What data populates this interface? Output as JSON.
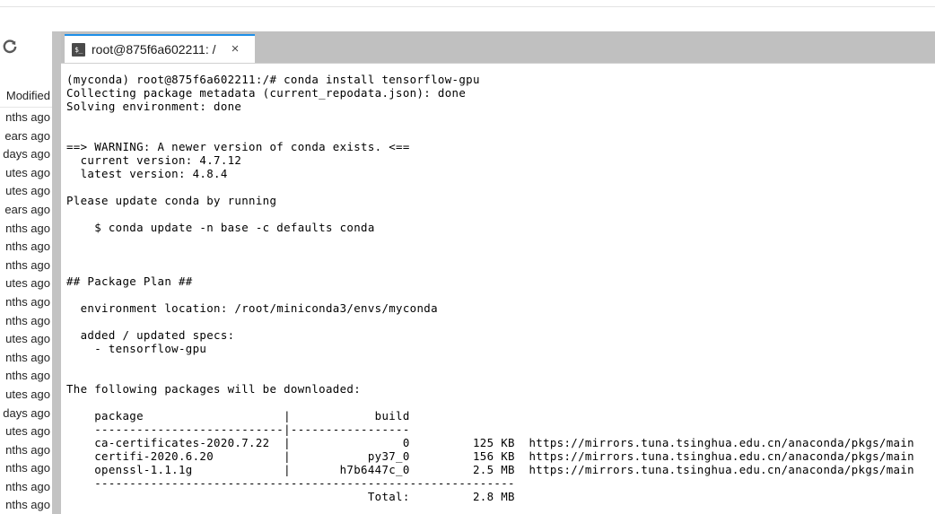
{
  "file_panel": {
    "refresh_icon": "refresh-icon",
    "column_header": "Modified",
    "rows": [
      {
        "modified": "nths ago"
      },
      {
        "modified": "ears ago"
      },
      {
        "modified": "days ago"
      },
      {
        "modified": "utes ago"
      },
      {
        "modified": "utes ago"
      },
      {
        "modified": "ears ago"
      },
      {
        "modified": "nths ago"
      },
      {
        "modified": "nths ago"
      },
      {
        "modified": "nths ago"
      },
      {
        "modified": "utes ago"
      },
      {
        "modified": "nths ago"
      },
      {
        "modified": "nths ago"
      },
      {
        "modified": "utes ago"
      },
      {
        "modified": "nths ago"
      },
      {
        "modified": "nths ago"
      },
      {
        "modified": "utes ago"
      },
      {
        "modified": "days ago"
      },
      {
        "modified": "utes ago"
      },
      {
        "modified": "nths ago"
      },
      {
        "modified": "nths ago"
      },
      {
        "modified": "nths ago"
      },
      {
        "modified": "nths ago"
      }
    ]
  },
  "terminal": {
    "tab": {
      "icon": "terminal-icon",
      "icon_glyph": "$_",
      "title": "root@875f6a602211: /",
      "close_label": "×",
      "accent_color": "#1d8fe8"
    },
    "prompt": "(myconda) root@875f6a602211:/#",
    "command": "conda install tensorflow-gpu",
    "conda": {
      "current_version": "4.7.12",
      "latest_version": "4.8.4",
      "update_command": "$ conda update -n base -c defaults conda",
      "environment_location": "/root/miniconda3/envs/myconda",
      "added_specs": [
        "tensorflow-gpu"
      ],
      "mirror_url": "https://mirrors.tuna.tsinghua.edu.cn/anaconda/pkgs/main",
      "packages": [
        {
          "package": "ca-certificates-2020.7.22",
          "build": "0",
          "size": "125 KB"
        },
        {
          "package": "certifi-2020.6.20",
          "build": "py37_0",
          "size": "156 KB"
        },
        {
          "package": "openssl-1.1.1g",
          "build": "h7b6447c_0",
          "size": "2.5 MB"
        }
      ],
      "total_label": "Total:",
      "total_size": "2.8 MB"
    },
    "output": "(myconda) root@875f6a602211:/# conda install tensorflow-gpu\nCollecting package metadata (current_repodata.json): done\nSolving environment: done\n\n\n==> WARNING: A newer version of conda exists. <==\n  current version: 4.7.12\n  latest version: 4.8.4\n\nPlease update conda by running\n\n    $ conda update -n base -c defaults conda\n\n\n\n## Package Plan ##\n\n  environment location: /root/miniconda3/envs/myconda\n\n  added / updated specs:\n    - tensorflow-gpu\n\n\nThe following packages will be downloaded:\n\n    package                    |            build\n    ---------------------------|-----------------\n    ca-certificates-2020.7.22  |                0         125 KB  https://mirrors.tuna.tsinghua.edu.cn/anaconda/pkgs/main\n    certifi-2020.6.20          |           py37_0         156 KB  https://mirrors.tuna.tsinghua.edu.cn/anaconda/pkgs/main\n    openssl-1.1.1g             |       h7b6447c_0         2.5 MB  https://mirrors.tuna.tsinghua.edu.cn/anaconda/pkgs/main\n    ------------------------------------------------------------\n                                           Total:         2.8 MB"
  }
}
